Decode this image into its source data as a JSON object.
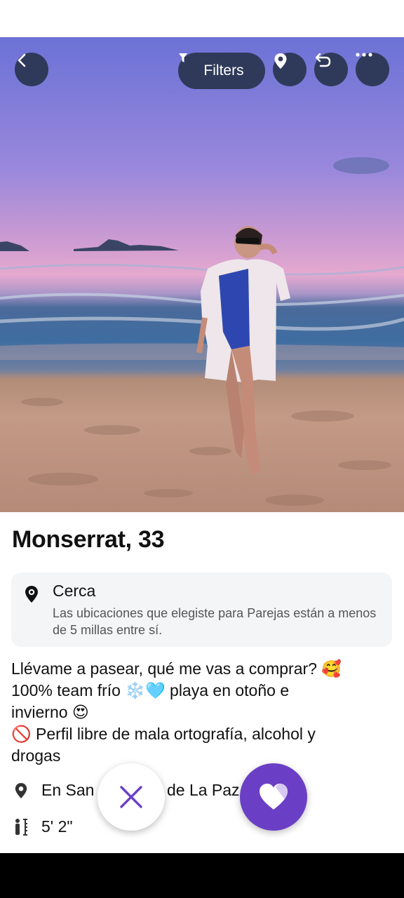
{
  "header": {
    "filters_label": "Filters"
  },
  "profile": {
    "name_age": "Monserrat, 33"
  },
  "location_card": {
    "title": "Cerca",
    "description": "Las ubicaciones que elegiste para Parejas están a menos de 5 millas entre sí."
  },
  "bio": {
    "lines": [
      "Llévame a pasear, qué me vas a comprar? 🥰",
      "100% team frío ❄️🩵 playa en otoño e",
      "invierno 😍",
      "🚫 Perfil libre de mala ortografía, alcohol y",
      "drogas"
    ]
  },
  "details": {
    "location": "En San Cristóbal de La Paz",
    "height": "5' 2\""
  },
  "icons": {
    "back": "back-arrow-icon",
    "filter": "filter-funnel-icon",
    "location": "location-pin-icon",
    "undo": "undo-icon",
    "more": "more-dots-icon",
    "pass": "close-x-icon",
    "like": "heart-icon",
    "height": "height-icon"
  },
  "colors": {
    "header_button": "#2f3a5a",
    "accent": "#6a3fc5",
    "card_bg": "#f4f5f7"
  }
}
